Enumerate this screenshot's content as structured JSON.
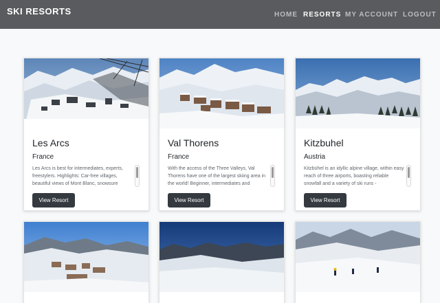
{
  "navbar": {
    "brand": "SKI RESORTS",
    "links": [
      "HOME",
      "RESORTS",
      "MY ACCOUNT",
      "LOGOUT"
    ],
    "active_link": "RESORTS"
  },
  "resorts": [
    {
      "name": "Les Arcs",
      "country": "France",
      "description": "Les Arcs is best for intermediates, experts, freestylers. Highlights: Car-free villages, beautiful views of Mont Blanc, snowsure",
      "button_label": "View Resort"
    },
    {
      "name": "Val Thorens",
      "country": "France",
      "description": "With the access of the Three Valleys, Val Thorens have one of the largest skiing area in the world! Beginner, intermediates and",
      "button_label": "View Resort"
    },
    {
      "name": "Kitzbuhel",
      "country": "Austria",
      "description": "Kitzbühel is an idyllic alpine village, within easy reach of three airports, boasting reliable snowfall and a variety of ski runs -",
      "button_label": "View Resort"
    }
  ],
  "colors": {
    "navbar_bg": "#5a5b5e",
    "page_bg": "#f8f9fa",
    "button_bg": "#343a40"
  }
}
